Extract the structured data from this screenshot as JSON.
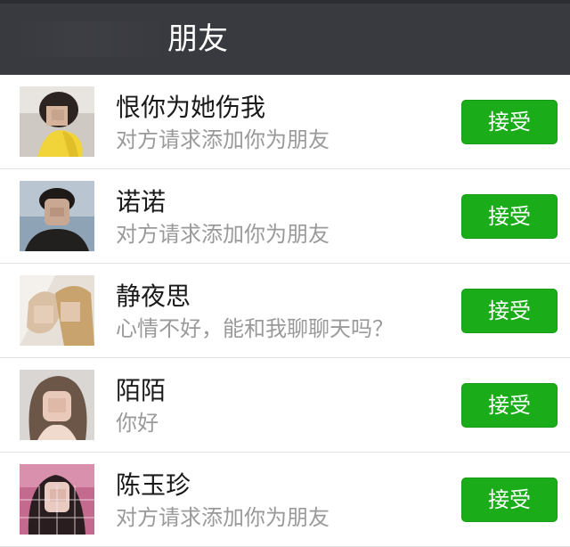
{
  "header": {
    "title": "朋友"
  },
  "requests": [
    {
      "name": "恨你为她伤我",
      "message": "对方请求添加你为朋友",
      "accept_label": "接受"
    },
    {
      "name": "诺诺",
      "message": "对方请求添加你为朋友",
      "accept_label": "接受"
    },
    {
      "name": "静夜思",
      "message": "心情不好，能和我聊聊天吗？",
      "accept_label": "接受"
    },
    {
      "name": "陌陌",
      "message": "你好",
      "accept_label": "接受"
    },
    {
      "name": "陈玉珍",
      "message": "对方请求添加你为朋友",
      "accept_label": "接受"
    }
  ],
  "colors": {
    "header_bg": "#393a3f",
    "accept_green": "#1aad19",
    "name_text": "#1a1a1a",
    "message_text": "#9a9a9a"
  }
}
